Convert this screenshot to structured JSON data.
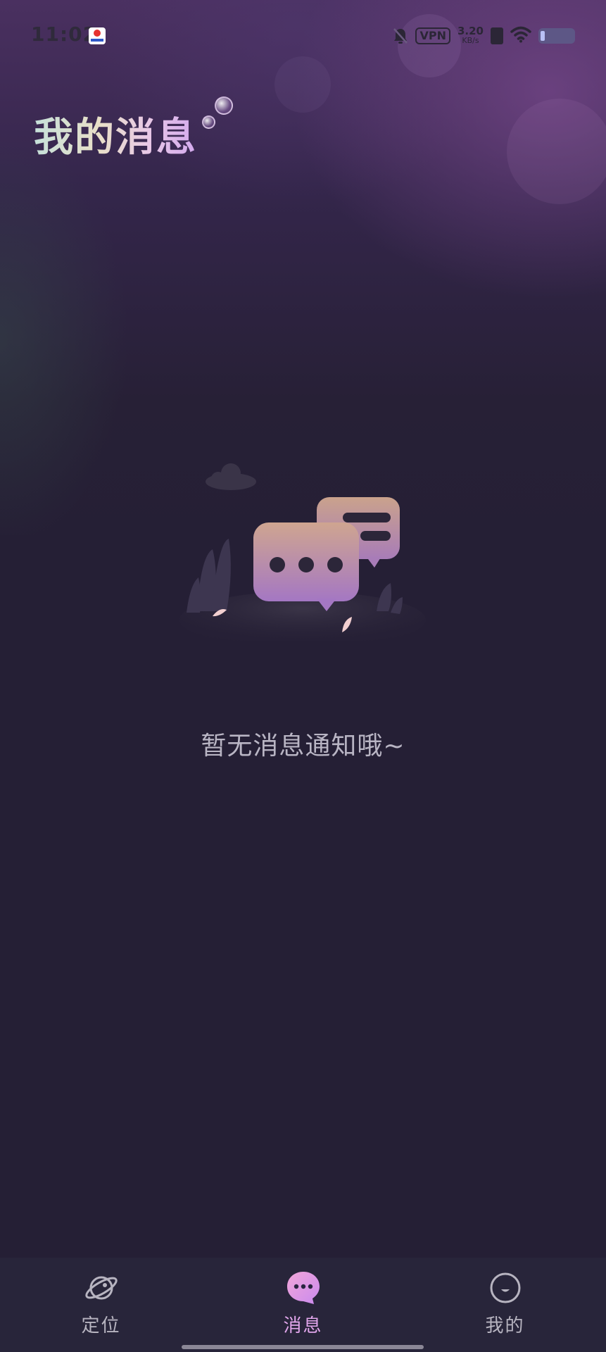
{
  "status_bar": {
    "time": "11:02",
    "vpn": "VPN",
    "net_speed_value": "3.20",
    "net_speed_unit": "KB/s"
  },
  "header": {
    "title": "我的消息"
  },
  "empty_state": {
    "message": "暂无消息通知哦~"
  },
  "bottom_nav": {
    "items": [
      {
        "label": "定位",
        "icon": "planet-icon",
        "active": false
      },
      {
        "label": "消息",
        "icon": "chat-bubble-icon",
        "active": true
      },
      {
        "label": "我的",
        "icon": "smile-face-icon",
        "active": false
      }
    ]
  },
  "colors": {
    "background": "#251f35",
    "nav_background": "#28253a",
    "active_tab": "#e2a6ec",
    "inactive_tab": "#b7b4c0",
    "empty_text": "#b9b5c4"
  }
}
